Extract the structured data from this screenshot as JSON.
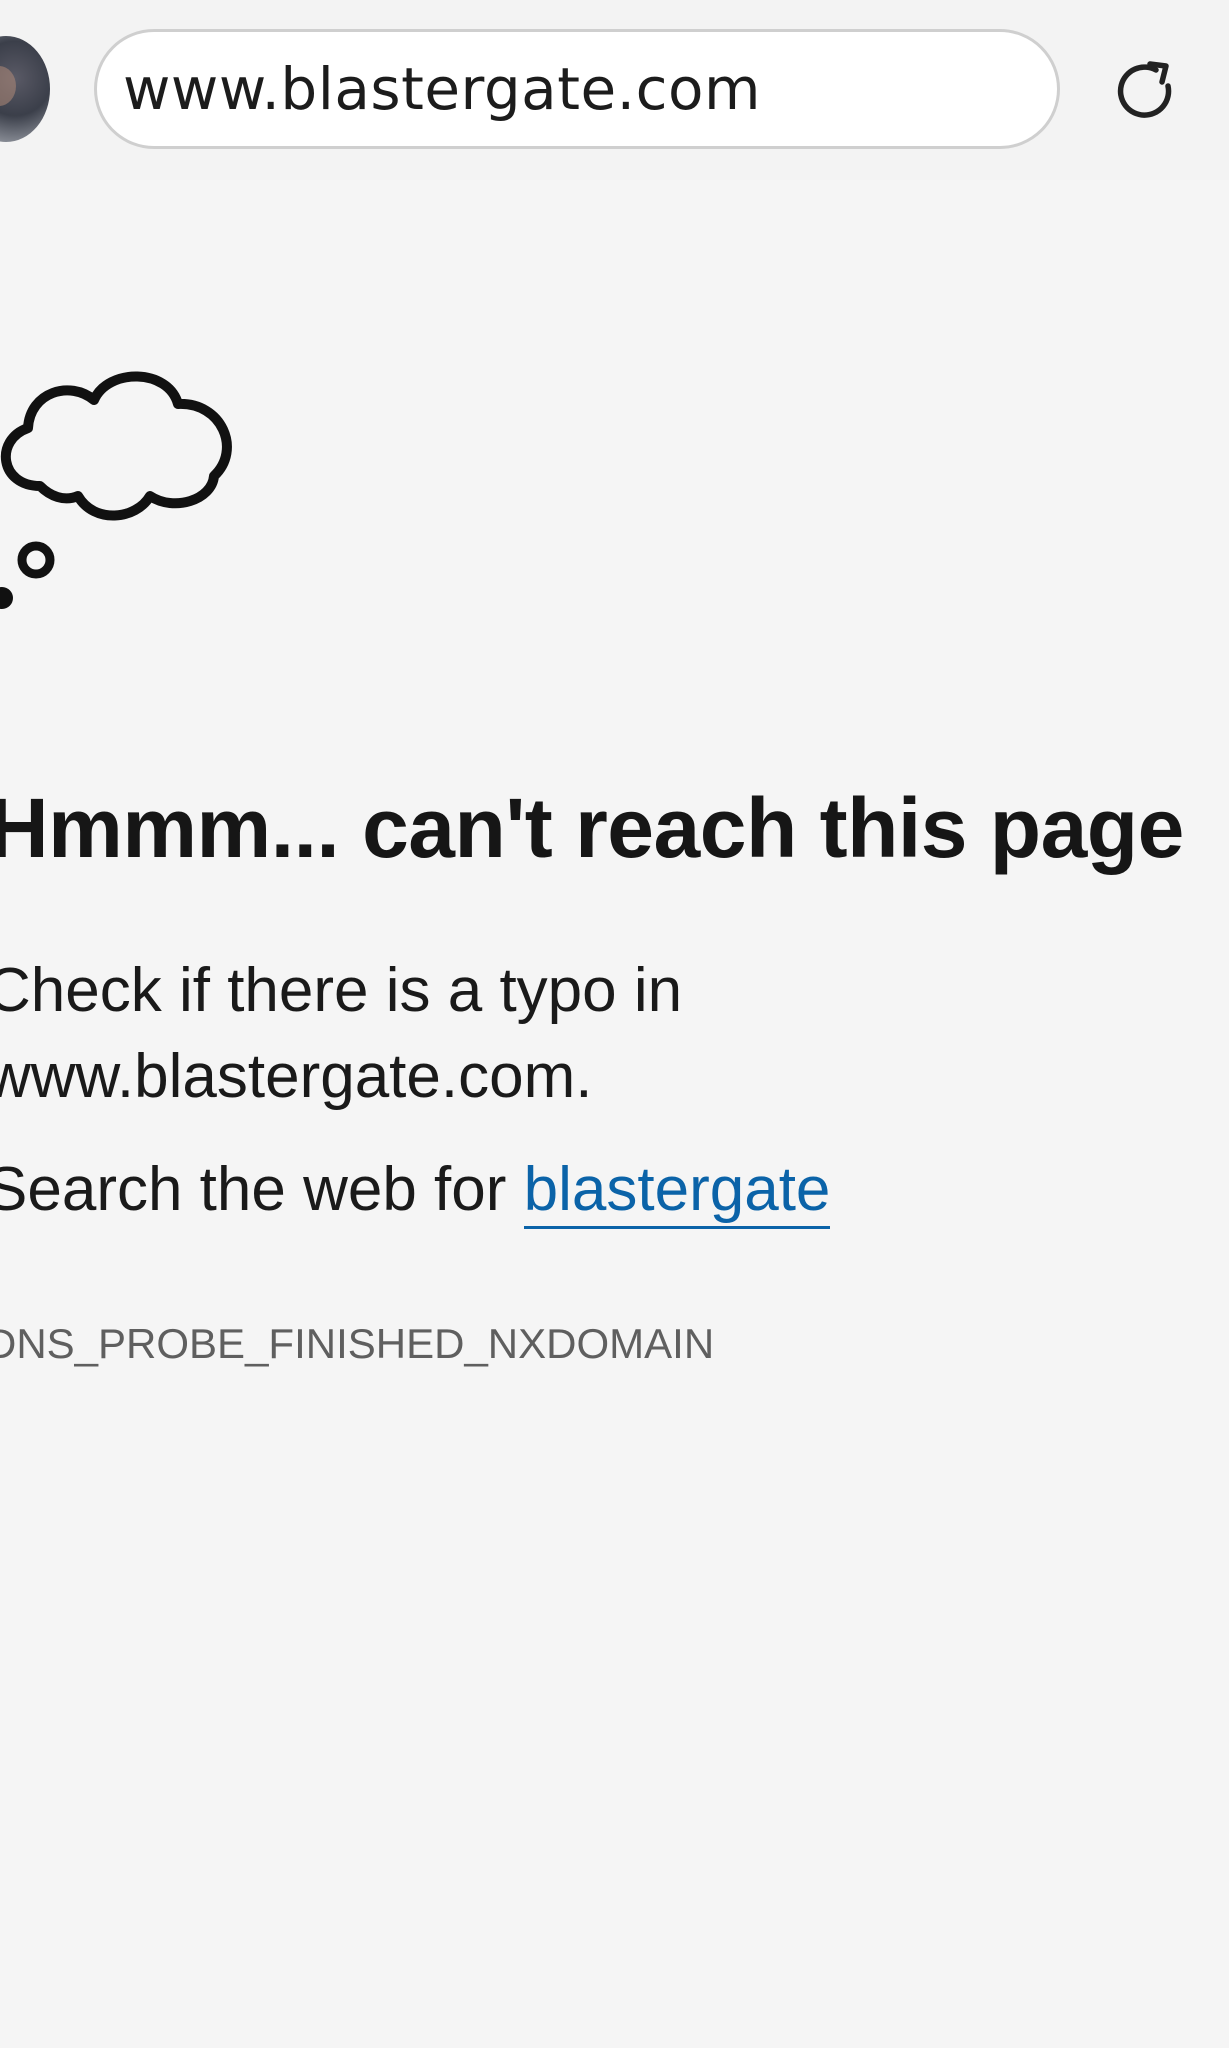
{
  "browser": {
    "address_bar": {
      "url": "www.blastergate.com"
    },
    "avatar_icon": "profile-avatar",
    "reload_icon": "reload-icon"
  },
  "error_page": {
    "illustration_icon": "thought-cloud-icon",
    "heading": "Hmmm... can't reach this page",
    "typo_message": "Check if there is a typo in www.blastergate.com.",
    "search_prefix": "Search the web for ",
    "search_term": "blastergate",
    "error_code": "DNS_PROBE_FINISHED_NXDOMAIN"
  },
  "colors": {
    "background": "#f5f5f5",
    "link": "#0b63a8",
    "error_code": "#5f5f5f"
  }
}
